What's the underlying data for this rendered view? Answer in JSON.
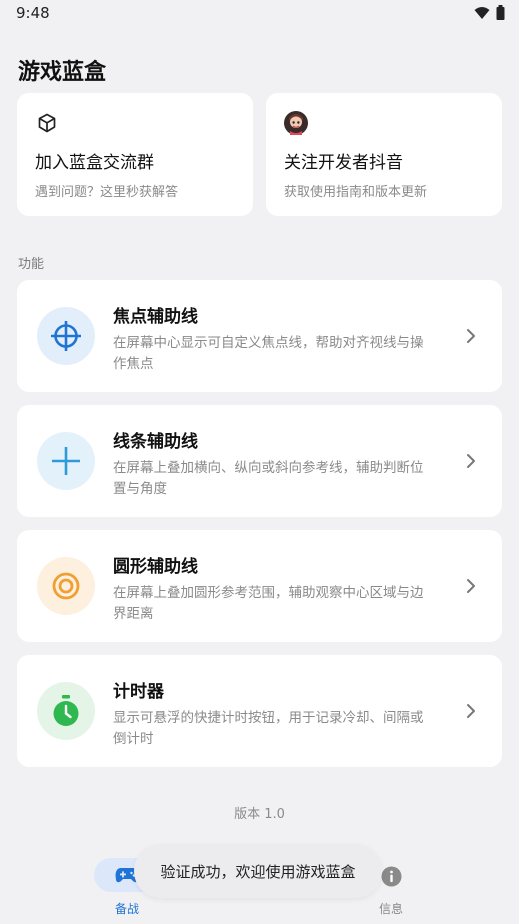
{
  "status": {
    "time": "9:48"
  },
  "app": {
    "title": "游戏蓝盒"
  },
  "top_cards": [
    {
      "title": "加入蓝盒交流群",
      "subtitle": "遇到问题？这里秒获解答",
      "icon": "cube-icon"
    },
    {
      "title": "关注开发者抖音",
      "subtitle": "获取使用指南和版本更新",
      "icon": "avatar"
    }
  ],
  "section": {
    "label": "功能"
  },
  "features": [
    {
      "title": "焦点辅助线",
      "desc": "在屏幕中心显示可自定义焦点线，帮助对齐视线与操作焦点",
      "icon": "crosshair-icon",
      "bg": "#E3EEFB",
      "fg": "#1F74D6"
    },
    {
      "title": "线条辅助线",
      "desc": "在屏幕上叠加横向、纵向或斜向参考线，辅助判断位置与角度",
      "icon": "cross-lines-icon",
      "bg": "#E3F1FB",
      "fg": "#2D9BD8"
    },
    {
      "title": "圆形辅助线",
      "desc": "在屏幕上叠加圆形参考范围，辅助观察中心区域与边界距离",
      "icon": "target-circle-icon",
      "bg": "#FDF0DF",
      "fg": "#F0A033"
    },
    {
      "title": "计时器",
      "desc": "显示可悬浮的快捷计时按钮，用于记录冷却、间隔或倒计时",
      "icon": "stopwatch-icon",
      "bg": "#E4F5E8",
      "fg": "#2EB84F"
    }
  ],
  "footer": {
    "version": "版本 1.0"
  },
  "nav": [
    {
      "label": "备战",
      "icon": "gamepad-icon",
      "active": true,
      "color": "#1F74D6"
    },
    {
      "label": "信息",
      "icon": "info-icon",
      "active": false,
      "color": "#888888"
    }
  ],
  "toast": {
    "text": "验证成功，欢迎使用游戏蓝盒"
  }
}
